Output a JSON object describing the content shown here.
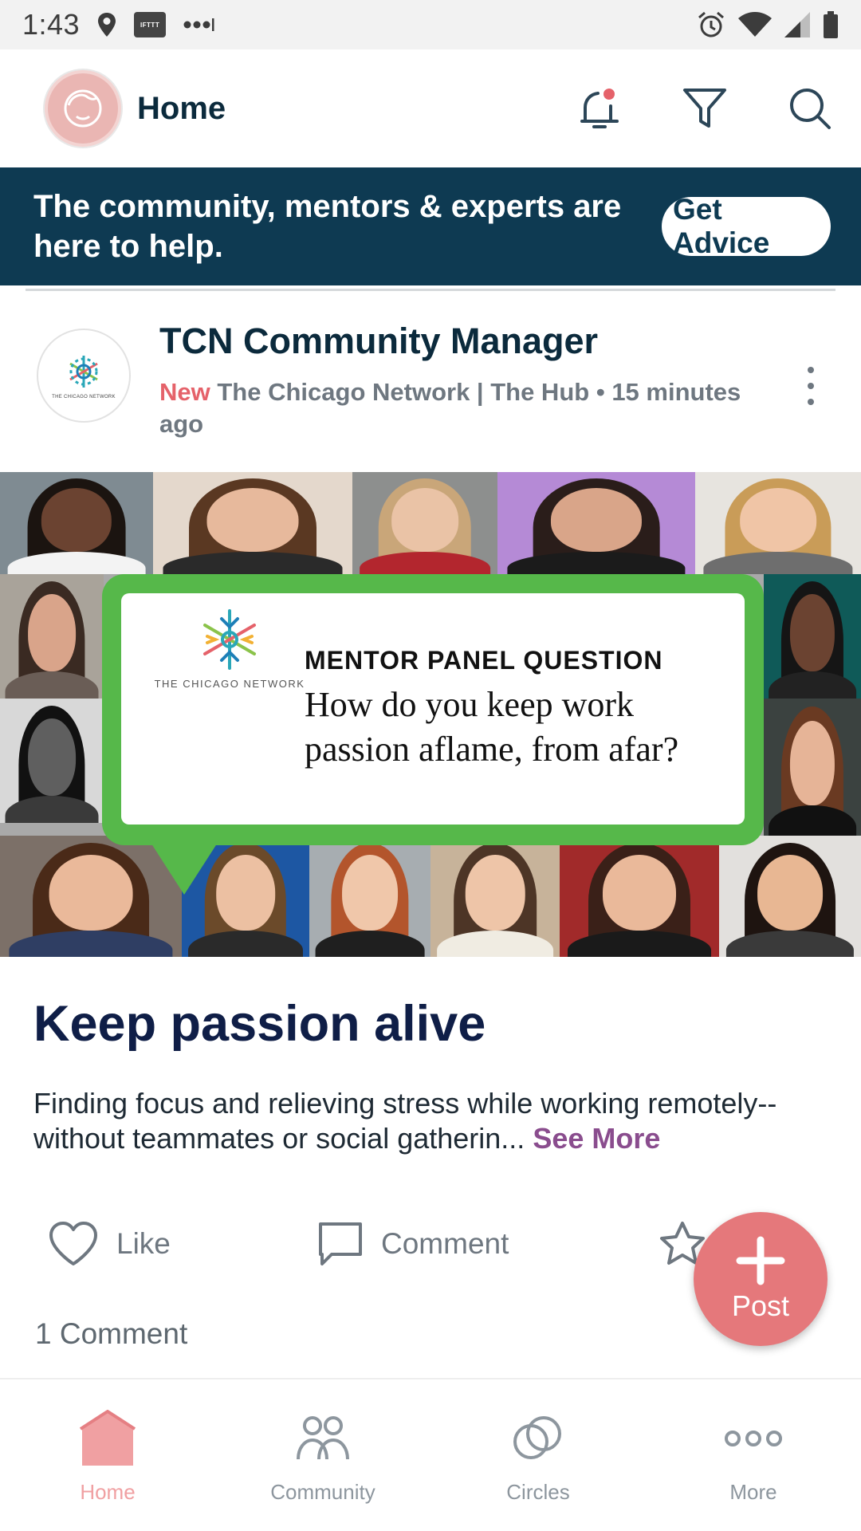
{
  "status_bar": {
    "time": "1:43",
    "ifttt_label": "IFTTT"
  },
  "header": {
    "title": "Home",
    "icons": [
      "notification-bell-icon",
      "filter-icon",
      "search-icon"
    ],
    "notification_dot_color": "#e5626a"
  },
  "banner": {
    "text": "The community, mentors & experts are here to help.",
    "button_label": "Get Advice",
    "background_color": "#0e3a52"
  },
  "post": {
    "author": "TCN Community Manager",
    "badge": "New",
    "source": "The Chicago Network | The Hub",
    "separator": "•",
    "time": "15 minutes ago",
    "avatar_caption": "THE CHICAGO NETWORK",
    "image": {
      "logo_caption": "THE CHICAGO NETWORK",
      "kicker": "MENTOR PANEL QUESTION",
      "question": "How do you keep work passion aflame, from afar?",
      "bubble_color": "#56b84a"
    },
    "title": "Keep passion alive",
    "excerpt": "Finding focus and relieving stress while working remotely--without teammates or social gatherin...",
    "see_more": "See More",
    "actions": {
      "like": "Like",
      "comment": "Comment"
    },
    "comment_count": "1 Comment"
  },
  "fab": {
    "label": "Post",
    "color": "#e5787b"
  },
  "bottom_nav": {
    "items": [
      {
        "label": "Home",
        "icon": "home-icon",
        "active": true
      },
      {
        "label": "Community",
        "icon": "community-icon",
        "active": false
      },
      {
        "label": "Circles",
        "icon": "circles-icon",
        "active": false
      },
      {
        "label": "More",
        "icon": "more-icon",
        "active": false
      }
    ],
    "active_color": "#f0a0a2"
  }
}
